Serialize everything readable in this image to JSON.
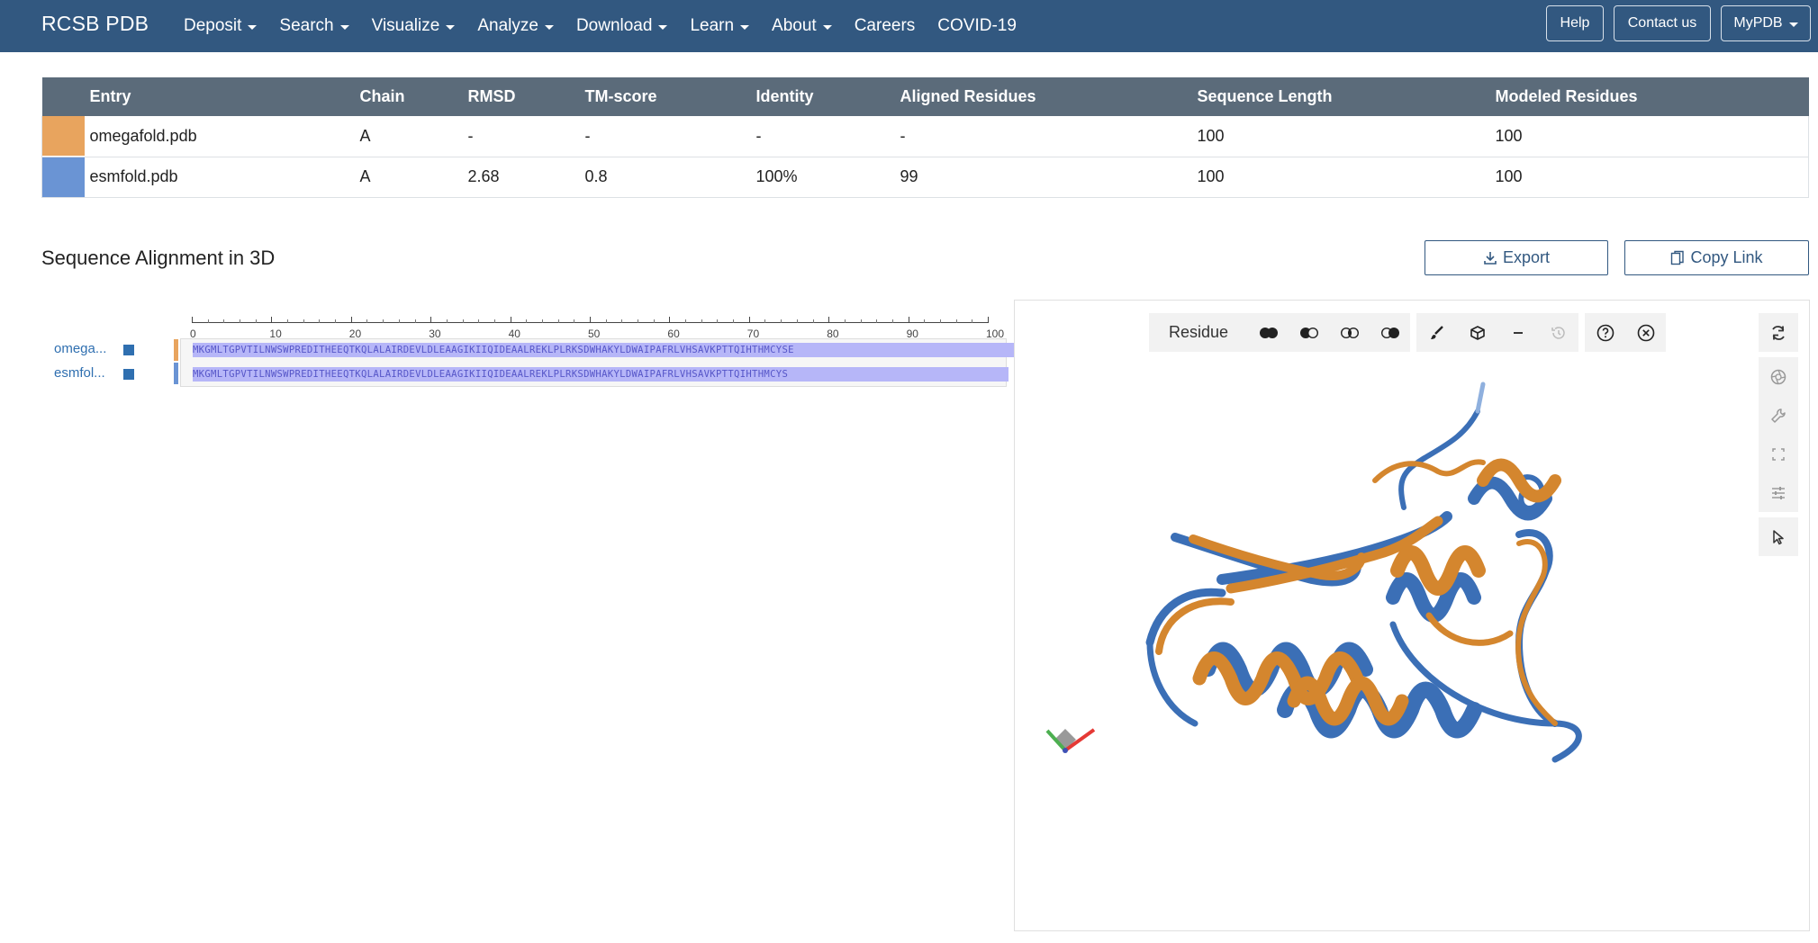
{
  "navbar": {
    "brand": "RCSB PDB",
    "items": [
      {
        "label": "Deposit",
        "dropdown": true
      },
      {
        "label": "Search",
        "dropdown": true
      },
      {
        "label": "Visualize",
        "dropdown": true
      },
      {
        "label": "Analyze",
        "dropdown": true
      },
      {
        "label": "Download",
        "dropdown": true
      },
      {
        "label": "Learn",
        "dropdown": true
      },
      {
        "label": "About",
        "dropdown": true
      },
      {
        "label": "Careers",
        "dropdown": false
      },
      {
        "label": "COVID-19",
        "dropdown": false
      }
    ],
    "help": "Help",
    "contact": "Contact us",
    "mypdb": "MyPDB"
  },
  "table": {
    "headers": [
      "Entry",
      "Chain",
      "RMSD",
      "TM-score",
      "Identity",
      "Aligned Residues",
      "Sequence Length",
      "Modeled Residues"
    ],
    "rows": [
      {
        "color": "#e8a45e",
        "entry": "omegafold.pdb",
        "chain": "A",
        "rmsd": "-",
        "tm": "-",
        "identity": "-",
        "aligned": "-",
        "seqlen": "100",
        "modeled": "100"
      },
      {
        "color": "#6a94d4",
        "entry": "esmfold.pdb",
        "chain": "A",
        "rmsd": "2.68",
        "tm": "0.8",
        "identity": "100%",
        "aligned": "99",
        "seqlen": "100",
        "modeled": "100"
      }
    ]
  },
  "alignment": {
    "title": "Sequence Alignment in 3D",
    "export": "Export",
    "copy_link": "Copy Link",
    "ruler_ticks": [
      "0",
      "10",
      "20",
      "30",
      "40",
      "50",
      "60",
      "70",
      "80",
      "90",
      "100"
    ],
    "sequences": [
      {
        "label": "omega...",
        "color": "#e8a45e",
        "seq": "MKGMLTGPVTILNWSWPREDITHEEQTKQLALAIRDEVLDLEAAGIKIIQIDEAALREKLPLRKSDWHAKYLDWAIPAFRLVHSAVKPTTQIHTHMCYSE"
      },
      {
        "label": "esmfol...",
        "color": "#6a94d4",
        "seq": "MKGMLTGPVTILNWSWPREDITHEEQTKQLALAIRDEVLDLEAAGIKIIQIDEAALREKLPLRKSDWHAKYLDWAIPAFRLVHSAVKPTTQIHTHMCYS"
      }
    ]
  },
  "viewer": {
    "mode_label": "Residue",
    "colors": {
      "structure_a": "#d4862e",
      "structure_b": "#3b6fb6"
    }
  }
}
